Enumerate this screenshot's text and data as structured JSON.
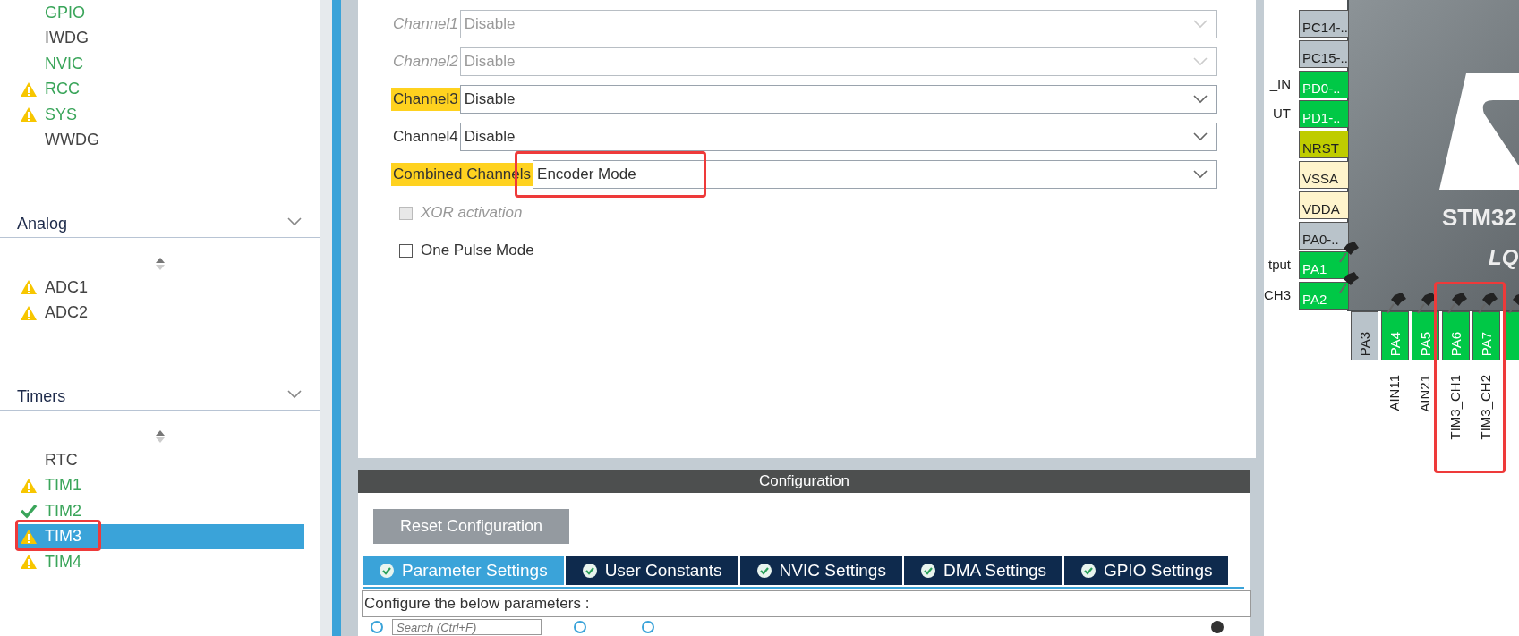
{
  "sidebar": {
    "groups": [
      {
        "items": [
          {
            "label": "GPIO",
            "kind": "plain",
            "configured": true,
            "selected": false,
            "marked": false
          },
          {
            "label": "IWDG",
            "kind": "plain",
            "configured": false,
            "selected": false,
            "marked": false
          },
          {
            "label": "NVIC",
            "kind": "plain",
            "configured": true,
            "selected": false,
            "marked": false
          },
          {
            "label": "RCC",
            "kind": "warning",
            "configured": true,
            "selected": false,
            "marked": false
          },
          {
            "label": "SYS",
            "kind": "warning",
            "configured": true,
            "selected": false,
            "marked": false
          },
          {
            "label": "WWDG",
            "kind": "plain",
            "configured": false,
            "selected": false,
            "marked": false
          }
        ]
      },
      {
        "title": "Analog",
        "items": [
          {
            "label": "ADC1",
            "kind": "warning",
            "configured": false,
            "selected": false,
            "marked": false
          },
          {
            "label": "ADC2",
            "kind": "warning",
            "configured": false,
            "selected": false,
            "marked": false
          }
        ]
      },
      {
        "title": "Timers",
        "items": [
          {
            "label": "RTC",
            "kind": "plain",
            "configured": false,
            "selected": false,
            "marked": false
          },
          {
            "label": "TIM1",
            "kind": "warning",
            "configured": true,
            "selected": false,
            "marked": false
          },
          {
            "label": "TIM2",
            "kind": "ok",
            "configured": true,
            "selected": false,
            "marked": false
          },
          {
            "label": "TIM3",
            "kind": "warning",
            "selected": true,
            "marked": true
          },
          {
            "label": "TIM4",
            "kind": "warning",
            "configured": true,
            "selected": false,
            "marked": false
          }
        ]
      }
    ]
  },
  "mode": {
    "fields": [
      {
        "label": "Channel1",
        "value": "Disable",
        "disabled": true,
        "highlighted": false,
        "marked": false
      },
      {
        "label": "Channel2",
        "value": "Disable",
        "disabled": true,
        "highlighted": false,
        "marked": false
      },
      {
        "label": "Channel3",
        "value": "Disable",
        "disabled": false,
        "highlighted": true,
        "marked": false
      },
      {
        "label": "Channel4",
        "value": "Disable",
        "disabled": false,
        "highlighted": false,
        "marked": false
      },
      {
        "label": "Combined Channels",
        "value": "Encoder Mode",
        "disabled": false,
        "highlighted": true,
        "marked": true
      }
    ],
    "checkboxes": [
      {
        "label": "XOR activation",
        "checked": false,
        "disabled": true
      },
      {
        "label": "One Pulse Mode",
        "checked": false,
        "disabled": false
      }
    ]
  },
  "configuration": {
    "title": "Configuration",
    "reset_button": "Reset Configuration",
    "tabs": [
      {
        "label": "Parameter Settings",
        "selected": true
      },
      {
        "label": "User Constants",
        "selected": false
      },
      {
        "label": "NVIC Settings",
        "selected": false
      },
      {
        "label": "DMA Settings",
        "selected": false
      },
      {
        "label": "GPIO Settings",
        "selected": false
      }
    ],
    "hint": "Configure the below parameters :",
    "search": {
      "placeholder": "Search (Ctrl+F)"
    }
  },
  "chip": {
    "name": "STM32",
    "package": "LQ",
    "left_pins": [
      {
        "label": "PC14-..",
        "kind": "io",
        "assigned": false,
        "pinned": false
      },
      {
        "label": "PC15-..",
        "kind": "io",
        "assigned": false,
        "pinned": false
      },
      {
        "label": "PD0-..",
        "kind": "io",
        "assigned": true,
        "pinned": false,
        "signal": "_IN"
      },
      {
        "label": "PD1-..",
        "kind": "io",
        "assigned": true,
        "pinned": false,
        "signal": "UT"
      },
      {
        "label": "NRST",
        "kind": "reset",
        "pinned": false
      },
      {
        "label": "VSSA",
        "kind": "power",
        "pinned": false
      },
      {
        "label": "VDDA",
        "kind": "power",
        "pinned": false
      },
      {
        "label": "PA0-..",
        "kind": "io",
        "assigned": false,
        "pinned": false
      },
      {
        "label": "PA1",
        "kind": "io",
        "assigned": true,
        "pinned": true,
        "signal": "tput"
      },
      {
        "label": "PA2",
        "kind": "io",
        "assigned": true,
        "pinned": true,
        "signal": "CH3"
      }
    ],
    "bottom_pins": [
      {
        "label": "PA3",
        "kind": "io",
        "assigned": false,
        "pinned": false,
        "marked": false
      },
      {
        "label": "PA4",
        "kind": "io",
        "assigned": true,
        "pinned": true,
        "marked": false,
        "signal": "AIN11"
      },
      {
        "label": "PA5",
        "kind": "io",
        "assigned": true,
        "pinned": true,
        "marked": false,
        "signal": "AIN21"
      },
      {
        "label": "PA6",
        "kind": "io",
        "assigned": true,
        "pinned": true,
        "marked": true,
        "signal": "TIM3_CH1"
      },
      {
        "label": "PA7",
        "kind": "io",
        "assigned": true,
        "pinned": true,
        "marked": true,
        "signal": "TIM3_CH2"
      },
      {
        "kind": "io",
        "assigned": true,
        "pinned": true,
        "marked": false
      }
    ]
  }
}
